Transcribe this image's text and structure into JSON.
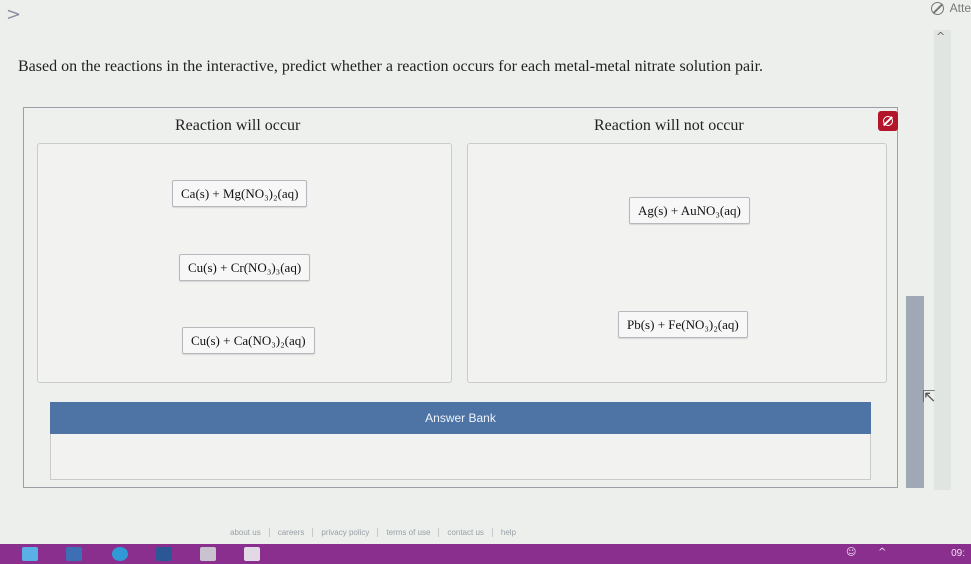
{
  "nav": {
    "back_glyph": ">"
  },
  "attempt": {
    "label": "Atte"
  },
  "question": {
    "text": "Based on the reactions in the interactive, predict whether a reaction occurs for each metal-metal nitrate solution pair."
  },
  "columns": {
    "left_header": "Reaction will occur",
    "right_header": "Reaction will not occur"
  },
  "left_items": [
    "Ca(s) + Mg(NO₃)₂(aq)",
    "Cu(s) + Cr(NO₃)₃(aq)",
    "Cu(s) + Ca(NO₃)₂(aq)"
  ],
  "right_items": [
    "Ag(s) + AuNO₃(aq)",
    "Pb(s) + Fe(NO₃)₂(aq)"
  ],
  "answer_bank": {
    "label": "Answer Bank"
  },
  "footer": [
    "about us",
    "careers",
    "privacy policy",
    "terms of use",
    "contact us",
    "help"
  ],
  "taskbar": {
    "time": "09:"
  },
  "colors": {
    "answer_bar": "#4e74a6",
    "clear_button": "#b3162b",
    "taskbar": "#8b2f8f"
  }
}
